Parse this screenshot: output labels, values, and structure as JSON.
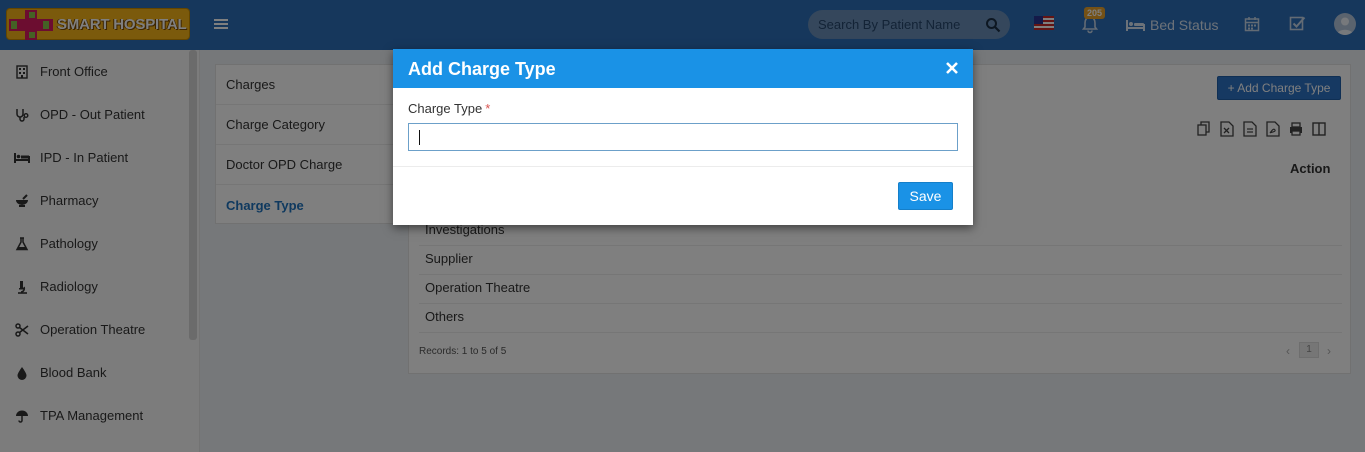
{
  "header": {
    "logo_text": "SMART HOSPITAL",
    "search": {
      "placeholder": "Search By Patient Name",
      "value": ""
    },
    "notification_count": "205",
    "bed_status_label": "Bed Status",
    "colors": {
      "bar": "#2c6fb8",
      "logo": "#f7b519"
    }
  },
  "sidebar": {
    "items": [
      {
        "label": "Front Office",
        "icon": "building-icon"
      },
      {
        "label": "OPD - Out Patient",
        "icon": "stethoscope-icon"
      },
      {
        "label": "IPD - In Patient",
        "icon": "bed-icon"
      },
      {
        "label": "Pharmacy",
        "icon": "mortar-pestle-icon"
      },
      {
        "label": "Pathology",
        "icon": "flask-icon"
      },
      {
        "label": "Radiology",
        "icon": "microscope-icon"
      },
      {
        "label": "Operation Theatre",
        "icon": "scissors-icon"
      },
      {
        "label": "Blood Bank",
        "icon": "tint-icon"
      },
      {
        "label": "TPA Management",
        "icon": "umbrella-icon"
      }
    ]
  },
  "subnav": {
    "items": [
      {
        "label": "Charges",
        "active": false
      },
      {
        "label": "Charge Category",
        "active": false
      },
      {
        "label": "Doctor OPD Charge",
        "active": false
      },
      {
        "label": "Charge Type",
        "active": true
      }
    ]
  },
  "panel": {
    "add_button_label": "+ Add Charge Type",
    "action_header": "Action",
    "rows": [
      "Investigations",
      "Supplier",
      "Operation Theatre",
      "Others"
    ],
    "records_text": "Records: 1 to 5 of 5",
    "pager": {
      "prev": "‹",
      "current": "1",
      "next": "›"
    }
  },
  "modal": {
    "title": "Add Charge Type",
    "close_symbol": "×",
    "field_label": "Charge Type",
    "required_mark": "*",
    "field_value": "",
    "save_label": "Save",
    "colors": {
      "header": "#1a92e6"
    }
  }
}
